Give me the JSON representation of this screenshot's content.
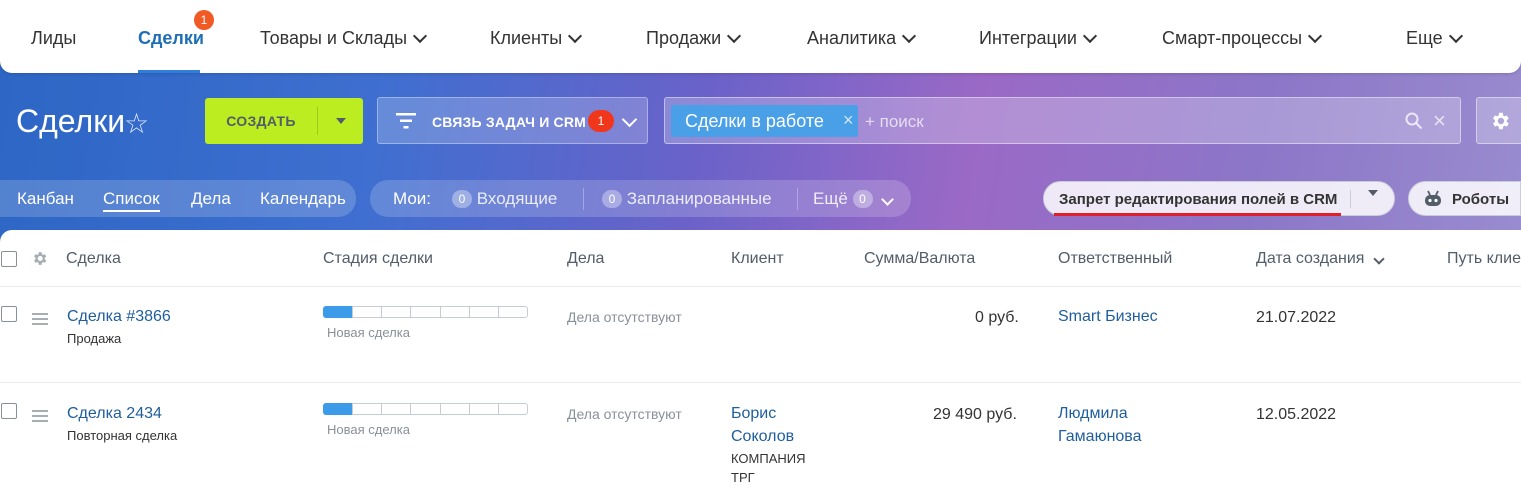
{
  "topnav": {
    "items": [
      {
        "label": "Лиды"
      },
      {
        "label": "Сделки",
        "badge": "1"
      },
      {
        "label": "Товары и Склады"
      },
      {
        "label": "Клиенты"
      },
      {
        "label": "Продажи"
      },
      {
        "label": "Аналитика"
      },
      {
        "label": "Интеграции"
      },
      {
        "label": "Смарт-процессы"
      },
      {
        "label": "Еще"
      }
    ]
  },
  "header": {
    "title": "Сделки",
    "create_label": "СОЗДАТЬ",
    "filter_label": "СВЯЗЬ ЗАДАЧ И CRM",
    "filter_badge": "1",
    "search_tag": "Сделки в работе",
    "search_placeholder": "+ поиск"
  },
  "toolbar": {
    "views": [
      "Канбан",
      "Список",
      "Дела",
      "Календарь"
    ],
    "mine_label": "Мои:",
    "incoming_count": "0",
    "incoming_label": "Входящие",
    "planned_count": "0",
    "planned_label": "Запланированные",
    "more_label": "Ещё",
    "more_count": "0",
    "preset_label": "Запрет редактирования полей в CRM",
    "robots_label": "Роботы"
  },
  "grid": {
    "columns": [
      "Сделка",
      "Стадия сделки",
      "Дела",
      "Клиент",
      "Сумма/Валюта",
      "Ответственный",
      "Дата создания",
      "Путь клие"
    ],
    "rows": [
      {
        "deal": "Сделка #3866",
        "deal_type": "Продажа",
        "stage": "Новая сделка",
        "stage_progress": 0.14,
        "activities": "Дела отсутствуют",
        "client_line1": "",
        "client_line2": "",
        "client_company1": "",
        "client_company2": "",
        "amount": "0 руб.",
        "responsible_line1": "Smart Бизнес",
        "responsible_line2": "",
        "created": "21.07.2022"
      },
      {
        "deal": "Сделка 2434",
        "deal_type": "Повторная сделка",
        "stage": "Новая сделка",
        "stage_progress": 0.14,
        "activities": "Дела отсутствуют",
        "client_line1": "Борис",
        "client_line2": "Соколов",
        "client_company1": "КОМПАНИЯ",
        "client_company2": "ТРГ",
        "amount": "29 490 руб.",
        "responsible_line1": "Людмила",
        "responsible_line2": "Гамаюнова",
        "created": "12.05.2022"
      }
    ]
  }
}
